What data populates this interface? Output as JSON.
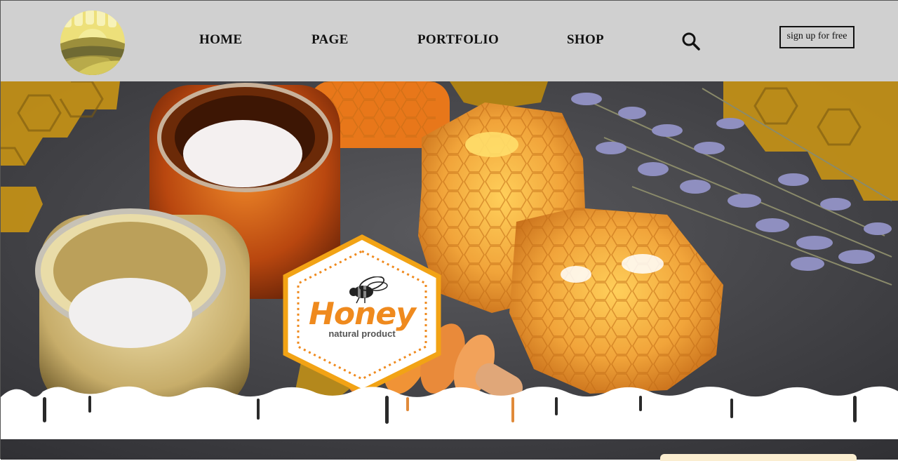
{
  "header": {
    "nav": [
      {
        "label": "HOME"
      },
      {
        "label": "PAGE"
      },
      {
        "label": "PORTFOLIO"
      },
      {
        "label": "SHOP"
      }
    ],
    "search_icon": "search-icon",
    "signup_label": "sign up for free",
    "logo_icon": "farm-sun-logo"
  },
  "hero": {
    "badge": {
      "title": "Honey",
      "subtitle": "natural product",
      "icon": "bee-icon"
    },
    "colors": {
      "accent": "#ef8a1e",
      "header_bg": "#d0d0d0",
      "slate": "#4a4a4e"
    }
  }
}
